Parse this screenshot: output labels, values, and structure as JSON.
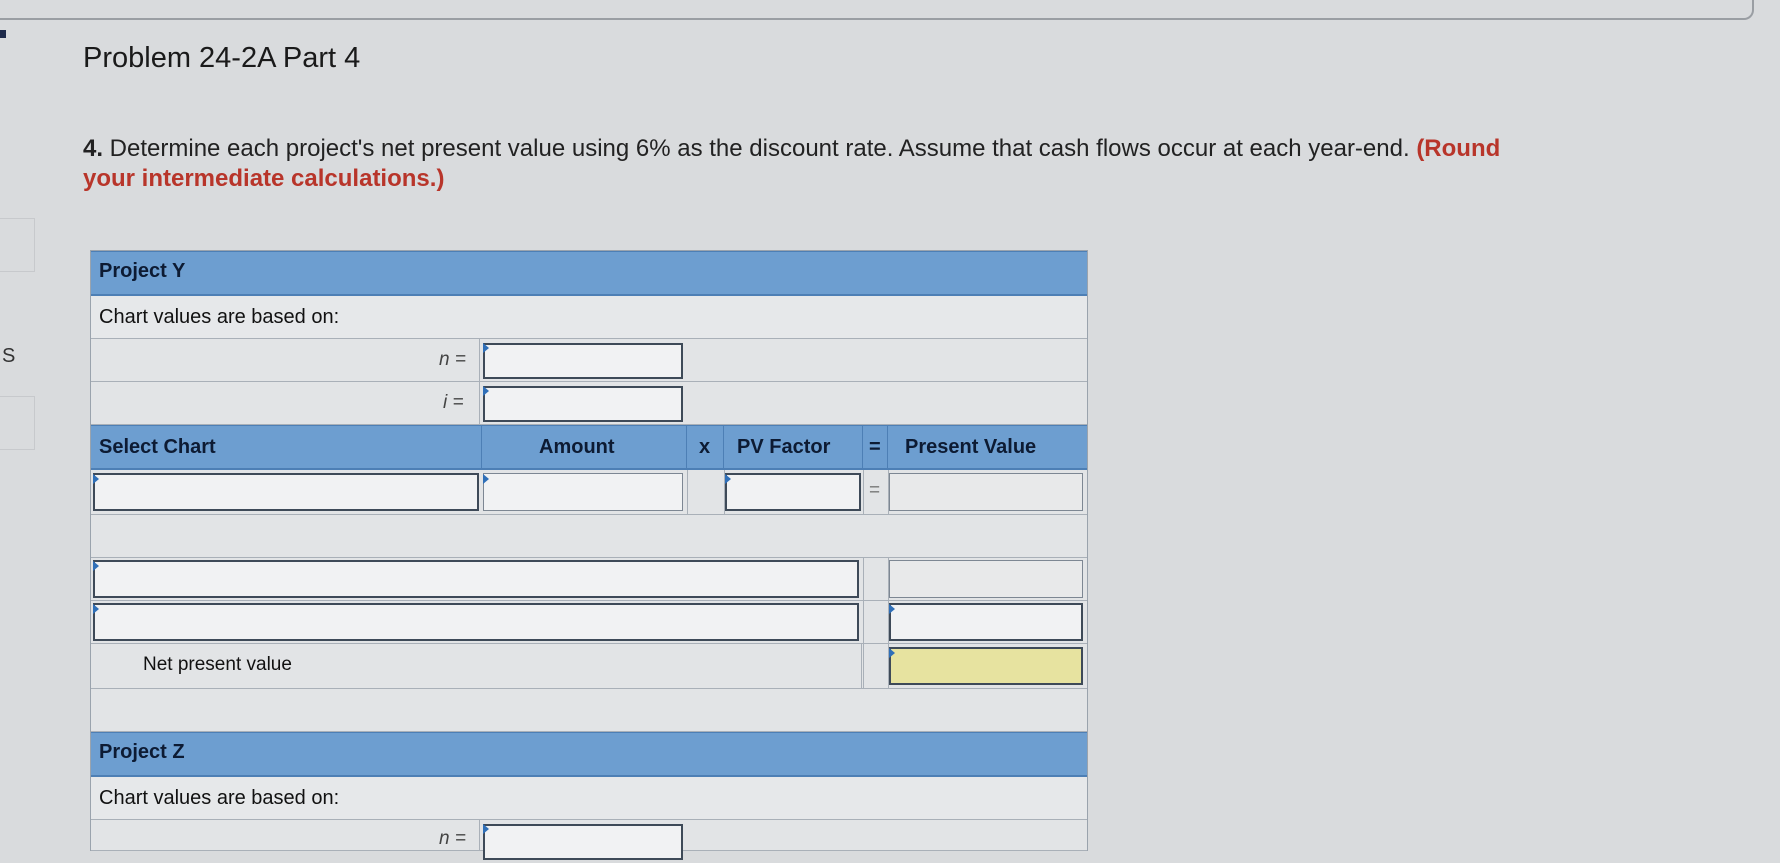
{
  "page": {
    "title": "Problem 24-2A Part 4",
    "instruction_num": "4.",
    "instruction_text": " Determine each project's net present value using 6% as the discount rate. Assume that cash flows occur at each year-end. ",
    "instruction_round_1": "(Round",
    "instruction_round_2": "your intermediate calculations.)",
    "left_letter": "S"
  },
  "project_y": {
    "header": "Project Y",
    "chart_basis": "Chart values are based on:",
    "n_label": "n =",
    "i_label": "i =",
    "n_value": "",
    "i_value": "",
    "col_select_chart": "Select Chart",
    "col_amount": "Amount",
    "op_times": "x",
    "col_pv_factor": "PV Factor",
    "op_equals": "=",
    "col_present_value": "Present Value",
    "row_equals": "=",
    "npv_label": "Net present value"
  },
  "project_z": {
    "header": "Project Z",
    "chart_basis": "Chart values are based on:",
    "n_label": "n ="
  },
  "colors": {
    "header_blue": "#6d9ed0",
    "npv_highlight": "#e7e3a0",
    "instruction_red": "#b8352a"
  }
}
